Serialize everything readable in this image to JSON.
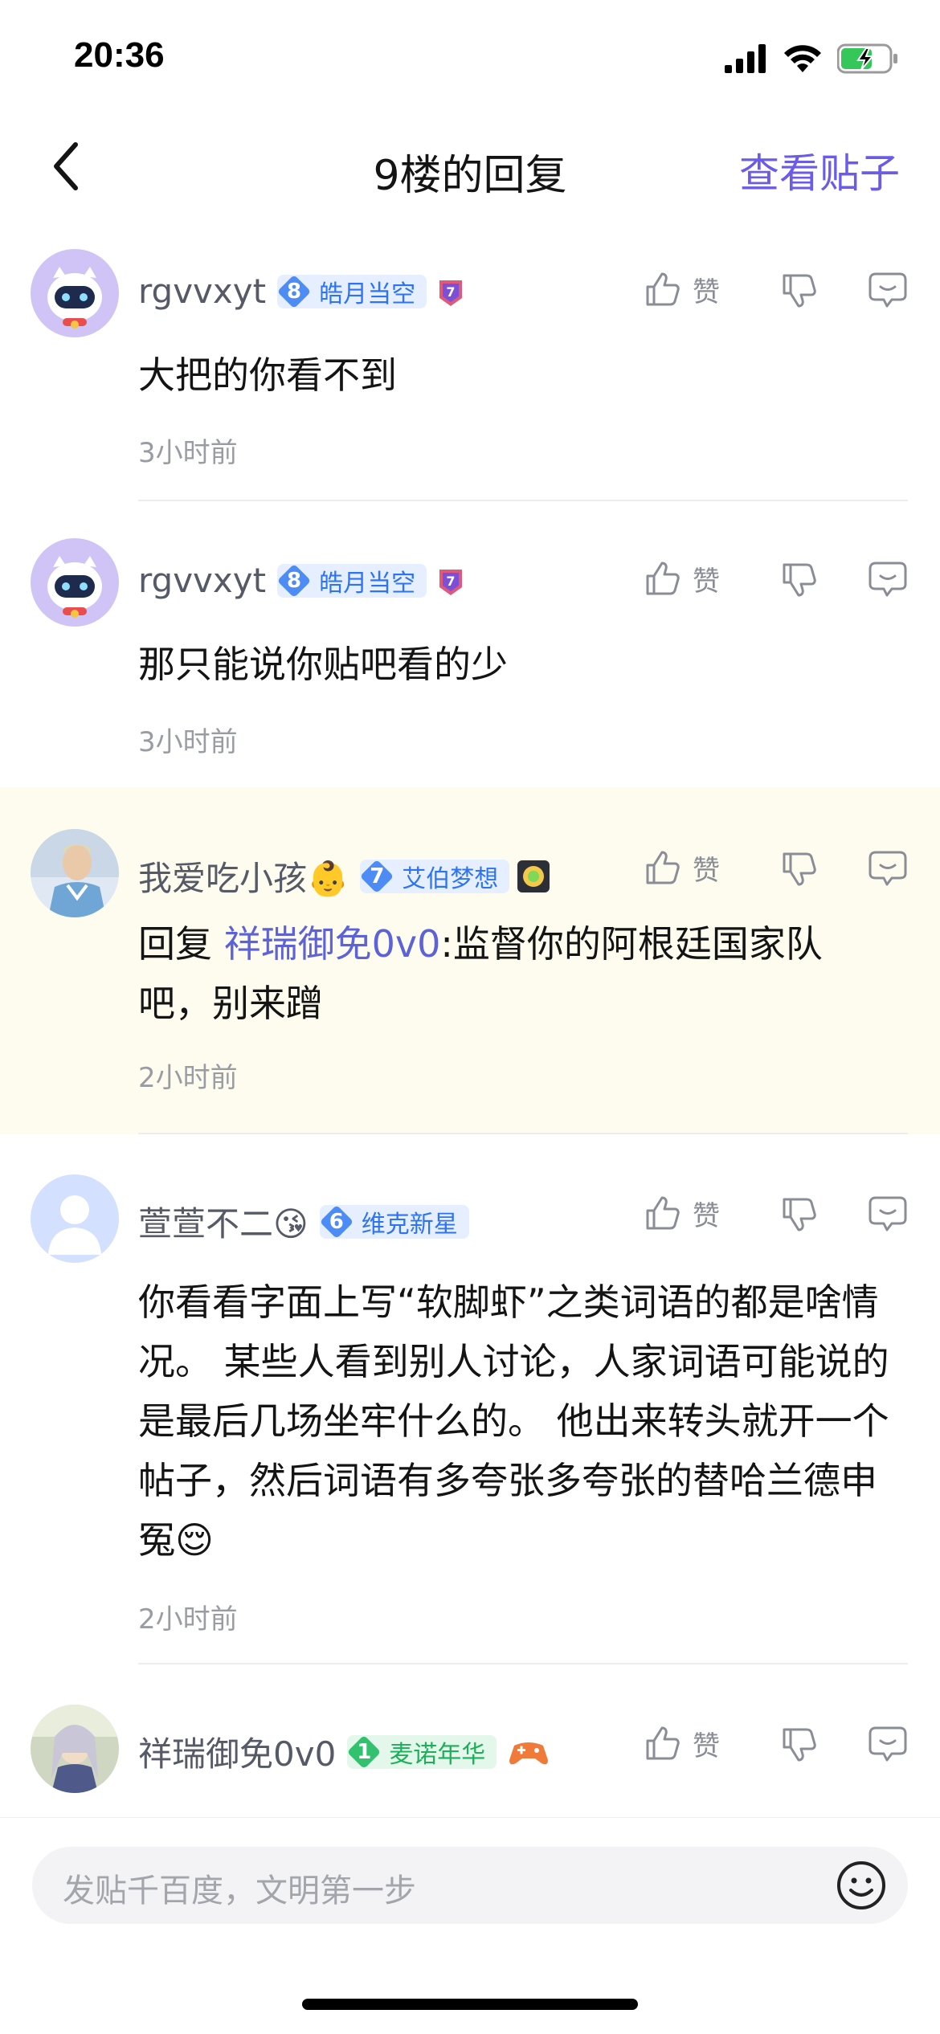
{
  "status_bar": {
    "time": "20:36"
  },
  "nav": {
    "title": "9楼的回复",
    "view_post": "查看贴子"
  },
  "replies": [
    {
      "username": "rgvvxyt",
      "level": "8",
      "level_title": "皓月当空",
      "like_label": "赞",
      "content": "大把的你看不到",
      "time": "3小时前"
    },
    {
      "username": "rgvvxyt",
      "level": "8",
      "level_title": "皓月当空",
      "like_label": "赞",
      "content": "那只能说你贴吧看的少",
      "time": "3小时前"
    },
    {
      "username": "我爱吃小孩👶",
      "level": "7",
      "level_title": "艾伯梦想",
      "like_label": "赞",
      "reply_prefix": "回复 ",
      "mention": "祥瑞御免0v0",
      "content": ":监督你的阿根廷国家队吧，别来蹭",
      "time": "2小时前"
    },
    {
      "username": "萱萱不二😘",
      "level": "6",
      "level_title": "维克新星",
      "like_label": "赞",
      "content": "你看看字面上写“软脚虾”之类词语的都是啥情况。 某些人看到别人讨论，人家词语可能说的是最后几场坐牢什么的。 他出来转头就开一个帖子，然后词语有多夸张多夸张的替哈兰德申冤😌",
      "time": "2小时前"
    },
    {
      "username": "祥瑞御免0v0",
      "level": "1",
      "level_title": "麦诺年华",
      "like_label": "赞"
    }
  ],
  "input": {
    "placeholder": "发贴千百度，文明第一步"
  },
  "colors": {
    "accent": "#6b5ce7",
    "mention": "#5d63d6",
    "level_blue": "#2e74f0",
    "level_green": "#1fae5b",
    "highlight_bg": "#fdfcef"
  },
  "icons": [
    "back-icon",
    "like-icon",
    "dislike-icon",
    "comment-icon",
    "emoji-icon",
    "signal-icon",
    "wifi-icon",
    "battery-icon"
  ]
}
